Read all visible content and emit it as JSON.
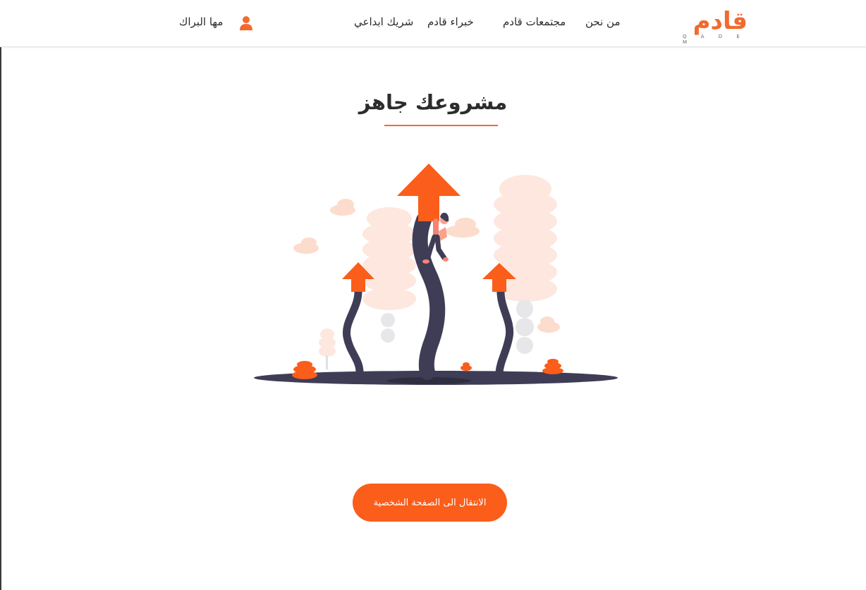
{
  "brand": {
    "logo_text": "قادم",
    "logo_sub": "Q A D E M"
  },
  "nav": {
    "items": [
      {
        "label": "من نحن"
      },
      {
        "label": "مجتمعات قادم"
      },
      {
        "label": "خبراء قادم"
      },
      {
        "label": "شريك ابداعي"
      }
    ]
  },
  "user": {
    "name": "مها البراك",
    "icon": "user-icon"
  },
  "main": {
    "title": "مشروعك جاهز",
    "illustration": "growth-arrows-illustration",
    "cta_label": "الانتقال الى الصفحة الشخصية"
  },
  "colors": {
    "accent": "#fb5d1a",
    "dark": "#3f3d56",
    "text": "#2b2b2b"
  }
}
